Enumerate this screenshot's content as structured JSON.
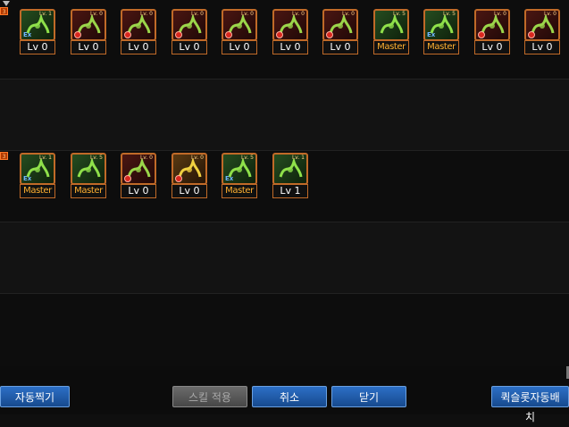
{
  "rows": [
    {
      "tag": "3",
      "skills": [
        {
          "level_label": "Lv 0",
          "mini": "Lv. 1",
          "badge": "ex",
          "tone": "green"
        },
        {
          "level_label": "Lv 0",
          "mini": "Lv. 0",
          "badge": "lock",
          "tone": "red"
        },
        {
          "level_label": "Lv 0",
          "mini": "Lv. 0",
          "badge": "lock",
          "tone": "red"
        },
        {
          "level_label": "Lv 0",
          "mini": "Lv. 0",
          "badge": "lock",
          "tone": "red"
        },
        {
          "level_label": "Lv 0",
          "mini": "Lv. 0",
          "badge": "lock",
          "tone": "red"
        },
        {
          "level_label": "Lv 0",
          "mini": "Lv. 0",
          "badge": "lock",
          "tone": "red"
        },
        {
          "level_label": "Lv 0",
          "mini": "Lv. 0",
          "badge": "lock",
          "tone": "red"
        },
        {
          "level_label": "Master",
          "mini": "Lv. 5",
          "badge": "none",
          "tone": "green"
        },
        {
          "level_label": "Master",
          "mini": "Lv. 5",
          "badge": "ex",
          "tone": "green"
        },
        {
          "level_label": "Lv 0",
          "mini": "Lv. 0",
          "badge": "lock",
          "tone": "red"
        },
        {
          "level_label": "Lv 0",
          "mini": "Lv. 0",
          "badge": "lock",
          "tone": "red"
        }
      ]
    },
    {
      "tag": "3",
      "skills": [
        {
          "level_label": "Master",
          "mini": "Lv. 1",
          "badge": "ex",
          "tone": "green"
        },
        {
          "level_label": "Master",
          "mini": "Lv. 5",
          "badge": "none",
          "tone": "green"
        },
        {
          "level_label": "Lv 0",
          "mini": "Lv. 0",
          "badge": "lock",
          "tone": "red"
        },
        {
          "level_label": "Lv 0",
          "mini": "Lv. 0",
          "badge": "lock",
          "tone": "gold"
        },
        {
          "level_label": "Master",
          "mini": "Lv. 5",
          "badge": "ex",
          "tone": "green"
        },
        {
          "level_label": "Lv 1",
          "mini": "Lv. 1",
          "badge": "none",
          "tone": "green"
        }
      ]
    }
  ],
  "buttons": {
    "auto_assign": "자동찍기",
    "apply_skill": "스킬 적용",
    "cancel": "취소",
    "close": "닫기",
    "quickslot_auto": "퀵슬롯자동배치"
  }
}
